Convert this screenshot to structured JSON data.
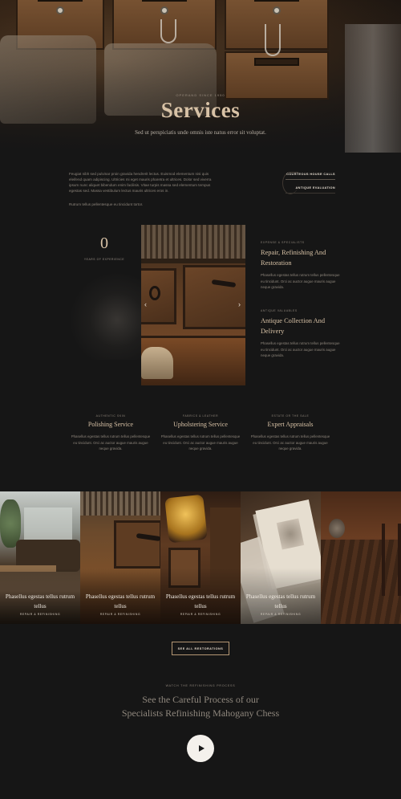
{
  "hero": {
    "kicker": "Operand Since 1950",
    "title": "Services",
    "subtitle": "Sed ut perspiciatis unde omnis iste natus error sit voluptat."
  },
  "intro": {
    "paragraph1": "Feugiat nibh sed pulvinar proin gravida hendrerit lectus. Euismod elementum nisi quis eleifend quam adipiscing. Ultricies mi eget mauris pharetra et ultrices. Dolor sed viverra ipsum nunc aliquet bibendum enim facilisis. Vitae turpis massa sed elementum tempus egestas sed. Massa vestibulum lectus mauris ultrices eros in.",
    "paragraph2": "Rutrum tellus pellentesque eu tincidunt tortor.",
    "links": [
      "Courteous House Calls",
      "Antique Evaluation"
    ]
  },
  "showcase": {
    "years_number": "0",
    "years_label": "Years of Experience",
    "services": [
      {
        "kicker": "Expense & Specialists",
        "title": "Repair, Refinishing And Restoration",
        "desc": "Phasellus egestas tellus rutrum tellus pellentesque eu tincidunt. Orci ac auctor augue mauris augue neque gravida."
      },
      {
        "kicker": "Antique Valuables",
        "title": "Antique Collection And Delivery",
        "desc": "Phasellus egestas tellus rutrum tellus pellentesque eu tincidunt. Orci ac auctor augue mauris augue neque gravida."
      }
    ]
  },
  "columns": [
    {
      "kicker": "Authentic Skin",
      "title": "Polishing Service",
      "desc": "Phasellus egestas tellus rutrum tellus pellentesque eu tincidunt. Orci ac auctor augue mauris augue neque gravida."
    },
    {
      "kicker": "Fabrics & Leather",
      "title": "Upholstering Service",
      "desc": "Phasellus egestas tellus rutrum tellus pellentesque eu tincidunt. Orci ac auctor augue mauris augue neque gravida."
    },
    {
      "kicker": "Estate or the Sale",
      "title": "Expert Appraisals",
      "desc": "Phasellus egestas tellus rutrum tellus pellentesque eu tincidunt. Orci ac auctor augue mauris augue neque gravida."
    }
  ],
  "gallery": [
    {
      "title": "Phasellus egestas tellus rutrum tellus",
      "kicker": "Repair & Refinishing"
    },
    {
      "title": "Phasellus egestas tellus rutrum tellus",
      "kicker": "Repair & Refinishing"
    },
    {
      "title": "Phasellus egestas tellus rutrum tellus",
      "kicker": "Repair & Refinishing"
    },
    {
      "title": "Phasellus egestas tellus rutrum tellus",
      "kicker": "Repair & Refinishing"
    },
    {
      "title": "",
      "kicker": ""
    }
  ],
  "cta": {
    "label": "See All Restorations"
  },
  "process": {
    "kicker": "Watch the Refinishing Process",
    "title_line1": "See the Careful Process of our",
    "title_line2": "Specialists Refinishing Mahogany Chess"
  },
  "colors": {
    "accent": "#d8c2a6",
    "background": "#161616",
    "button_border": "#b59774"
  }
}
